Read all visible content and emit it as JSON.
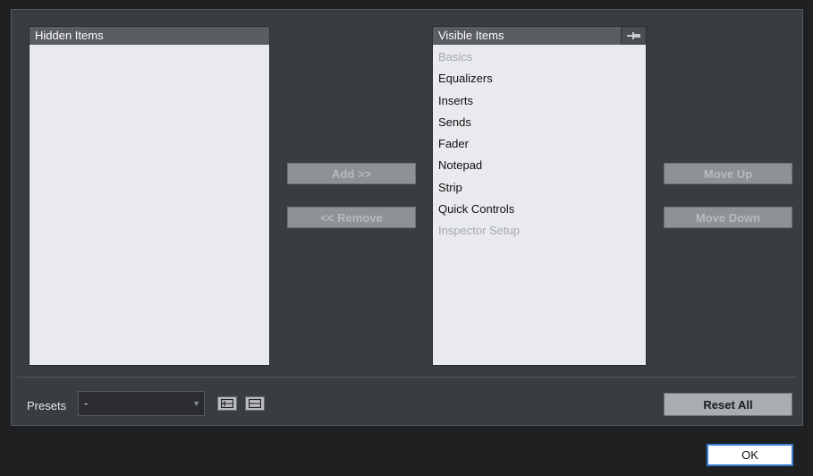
{
  "hidden_list": {
    "header": "Hidden Items",
    "items": []
  },
  "visible_list": {
    "header": "Visible Items",
    "items": [
      {
        "label": "Basics",
        "enabled": false
      },
      {
        "label": "Equalizers",
        "enabled": true
      },
      {
        "label": "Inserts",
        "enabled": true
      },
      {
        "label": "Sends",
        "enabled": true
      },
      {
        "label": "Fader",
        "enabled": true
      },
      {
        "label": "Notepad",
        "enabled": true
      },
      {
        "label": "Strip",
        "enabled": true
      },
      {
        "label": "Quick Controls",
        "enabled": true
      },
      {
        "label": "Inspector Setup",
        "enabled": false
      }
    ]
  },
  "buttons": {
    "add": "Add >>",
    "remove": "<< Remove",
    "move_up": "Move Up",
    "move_down": "Move Down",
    "reset_all": "Reset All",
    "ok": "OK"
  },
  "presets": {
    "label": "Presets",
    "value": "-"
  },
  "icons": {
    "pin": "pin-icon",
    "save_preset": "save-preset-icon",
    "delete_preset": "delete-preset-icon",
    "dropdown": "chevron-down-icon"
  },
  "colors": {
    "panel_bg": "#3a3d40",
    "list_bg": "#e8eaed",
    "header_bg": "#5a5d61",
    "ok_border": "#3b7bd0"
  }
}
